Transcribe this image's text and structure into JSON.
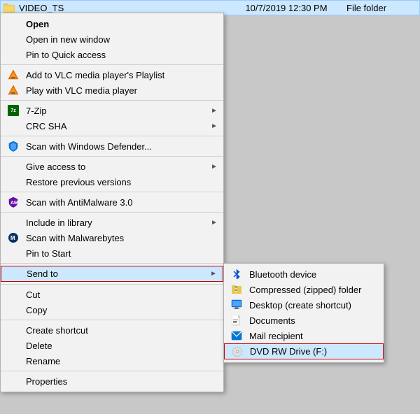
{
  "file": {
    "name": "VIDEO_TS",
    "date": "10/7/2019 12:30 PM",
    "type": "File folder"
  },
  "contextMenu": {
    "items": [
      {
        "id": "open",
        "label": "Open",
        "icon": null,
        "hasArrow": false,
        "bold": true,
        "dividerAfter": false
      },
      {
        "id": "open-new-window",
        "label": "Open in new window",
        "icon": null,
        "hasArrow": false,
        "dividerAfter": false
      },
      {
        "id": "pin-quick-access",
        "label": "Pin to Quick access",
        "icon": null,
        "hasArrow": false,
        "dividerAfter": false
      },
      {
        "id": "add-vlc-playlist",
        "label": "Add to VLC media player's Playlist",
        "icon": "vlc",
        "hasArrow": false,
        "dividerAfter": false
      },
      {
        "id": "play-vlc",
        "label": "Play with VLC media player",
        "icon": "vlc",
        "hasArrow": false,
        "dividerAfter": false
      },
      {
        "id": "7zip",
        "label": "7-Zip",
        "icon": "7zip",
        "hasArrow": true,
        "dividerAfter": false
      },
      {
        "id": "crc-sha",
        "label": "CRC SHA",
        "icon": null,
        "hasArrow": true,
        "dividerAfter": false
      },
      {
        "id": "scan-defender",
        "label": "Scan with Windows Defender...",
        "icon": "defender",
        "hasArrow": false,
        "dividerAfter": false
      },
      {
        "id": "give-access",
        "label": "Give access to",
        "icon": null,
        "hasArrow": true,
        "dividerAfter": false
      },
      {
        "id": "restore-previous",
        "label": "Restore previous versions",
        "icon": null,
        "hasArrow": false,
        "dividerAfter": false
      },
      {
        "id": "scan-antimalware",
        "label": "Scan with AntiMalware 3.0",
        "icon": "antimalware",
        "hasArrow": false,
        "dividerAfter": false
      },
      {
        "id": "include-library",
        "label": "Include in library",
        "icon": null,
        "hasArrow": true,
        "dividerAfter": false
      },
      {
        "id": "scan-malwarebytes",
        "label": "Scan with Malwarebytes",
        "icon": "malwarebytes",
        "hasArrow": false,
        "dividerAfter": false
      },
      {
        "id": "pin-start",
        "label": "Pin to Start",
        "icon": null,
        "hasArrow": false,
        "dividerAfter": false
      },
      {
        "id": "send-to",
        "label": "Send to",
        "icon": null,
        "hasArrow": true,
        "highlighted": true,
        "dividerAfter": false
      },
      {
        "id": "cut",
        "label": "Cut",
        "icon": null,
        "hasArrow": false,
        "dividerAfter": false
      },
      {
        "id": "copy",
        "label": "Copy",
        "icon": null,
        "hasArrow": false,
        "dividerAfter": false
      },
      {
        "id": "create-shortcut",
        "label": "Create shortcut",
        "icon": null,
        "hasArrow": false,
        "dividerAfter": false
      },
      {
        "id": "delete",
        "label": "Delete",
        "icon": null,
        "hasArrow": false,
        "dividerAfter": false
      },
      {
        "id": "rename",
        "label": "Rename",
        "icon": null,
        "hasArrow": false,
        "dividerAfter": false
      },
      {
        "id": "properties",
        "label": "Properties",
        "icon": null,
        "hasArrow": false,
        "dividerAfter": false
      }
    ]
  },
  "submenu": {
    "items": [
      {
        "id": "bluetooth",
        "label": "Bluetooth device",
        "icon": "bluetooth"
      },
      {
        "id": "compressed",
        "label": "Compressed (zipped) folder",
        "icon": "compressed"
      },
      {
        "id": "desktop",
        "label": "Desktop (create shortcut)",
        "icon": "desktop"
      },
      {
        "id": "documents",
        "label": "Documents",
        "icon": "documents"
      },
      {
        "id": "mail",
        "label": "Mail recipient",
        "icon": "mail"
      },
      {
        "id": "dvd",
        "label": "DVD RW Drive (F:)",
        "icon": "dvd",
        "highlighted": true
      }
    ]
  }
}
